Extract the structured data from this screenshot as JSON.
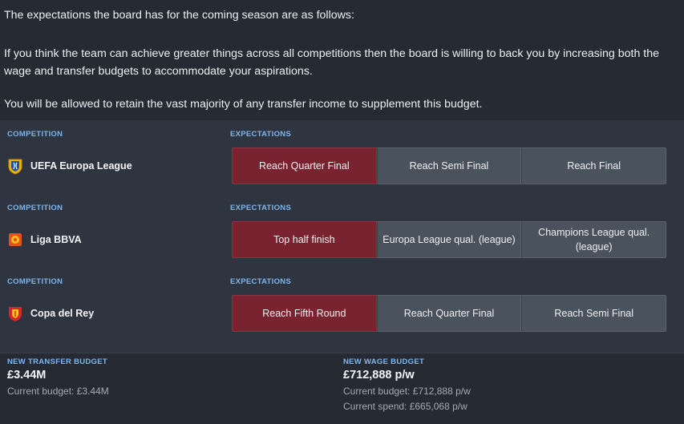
{
  "intro": {
    "line1": "The expectations the board has for the coming season are as follows:",
    "line2": "If you think the team can achieve greater things across all competitions then the board is willing to back you by increasing both the wage and transfer budgets to accommodate your aspirations.",
    "line3": "You will be allowed to retain the vast majority of any transfer income to supplement this budget."
  },
  "labels": {
    "competition": "COMPETITION",
    "expectations": "EXPECTATIONS"
  },
  "competitions": [
    {
      "name": "UEFA Europa League",
      "logo_icon": "europa-league-logo-icon",
      "options": [
        "Reach Quarter Final",
        "Reach Semi Final",
        "Reach Final"
      ],
      "selected": 0
    },
    {
      "name": "Liga BBVA",
      "logo_icon": "liga-bbva-logo-icon",
      "options": [
        "Top half finish",
        "Europa League qual. (league)",
        "Champions League qual. (league)"
      ],
      "selected": 0
    },
    {
      "name": "Copa del Rey",
      "logo_icon": "copa-del-rey-logo-icon",
      "options": [
        "Reach Fifth Round",
        "Reach Quarter Final",
        "Reach Semi Final"
      ],
      "selected": 0
    }
  ],
  "budgets": {
    "transfer": {
      "label": "NEW TRANSFER BUDGET",
      "value": "£3.44M",
      "current": "Current budget: £3.44M"
    },
    "wage": {
      "label": "NEW WAGE BUDGET",
      "value": "£712,888 p/w",
      "current": "Current budget: £712,888 p/w",
      "spend": "Current spend: £665,068 p/w"
    }
  },
  "colors": {
    "background": "#262b33",
    "panel": "#2f3540",
    "accent_label": "#7fb4ea",
    "selected_option": "#7a2330",
    "option": "#4a525d"
  }
}
